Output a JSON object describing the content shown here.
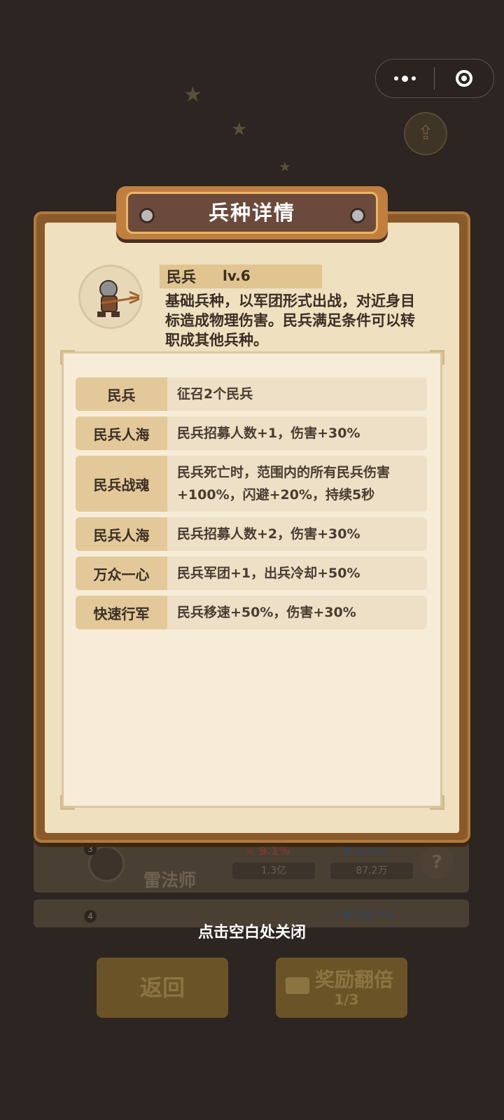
{
  "capsule": {
    "more_icon": "more-dots-icon",
    "close_icon": "target-circle-icon"
  },
  "modal": {
    "title": "兵种详情",
    "unit": {
      "name": "民兵",
      "level": "lv.6",
      "description": "基础兵种，以军团形式出战，对近身目标造成物理伤害。民兵满足条件可以转职成其他兵种。",
      "avatar_icon": "militia-pitchfork-icon"
    },
    "skills": [
      {
        "name": "民兵",
        "desc": "征召2个民兵"
      },
      {
        "name": "民兵人海",
        "desc": "民兵招募人数+1，伤害+30%"
      },
      {
        "name": "民兵战魂",
        "desc": "民兵死亡时，范围内的所有民兵伤害+100%，闪避+20%，持续5秒"
      },
      {
        "name": "民兵人海",
        "desc": "民兵招募人数+2，伤害+30%"
      },
      {
        "name": "万众一心",
        "desc": "民兵军团+1，出兵冷却+50%"
      },
      {
        "name": "快速行军",
        "desc": "民兵移速+50%，伤害+30%"
      }
    ]
  },
  "close_hint": "点击空白处关闭",
  "background": {
    "row": {
      "rank": "3",
      "name": "雷法师",
      "attack_pct": "9.1%",
      "attack_value": "1.3亿",
      "defense_pct": "3.9%",
      "defense_value": "87.2万"
    },
    "row_next": {
      "rank": "4",
      "defense_pct": "10.7%"
    },
    "back_button": "返回",
    "reward_button": "奖励翻倍",
    "reward_count": "1/3",
    "share_icon": "share-icon",
    "video_icon": "video-camera-icon",
    "help_icon": "question-icon"
  }
}
